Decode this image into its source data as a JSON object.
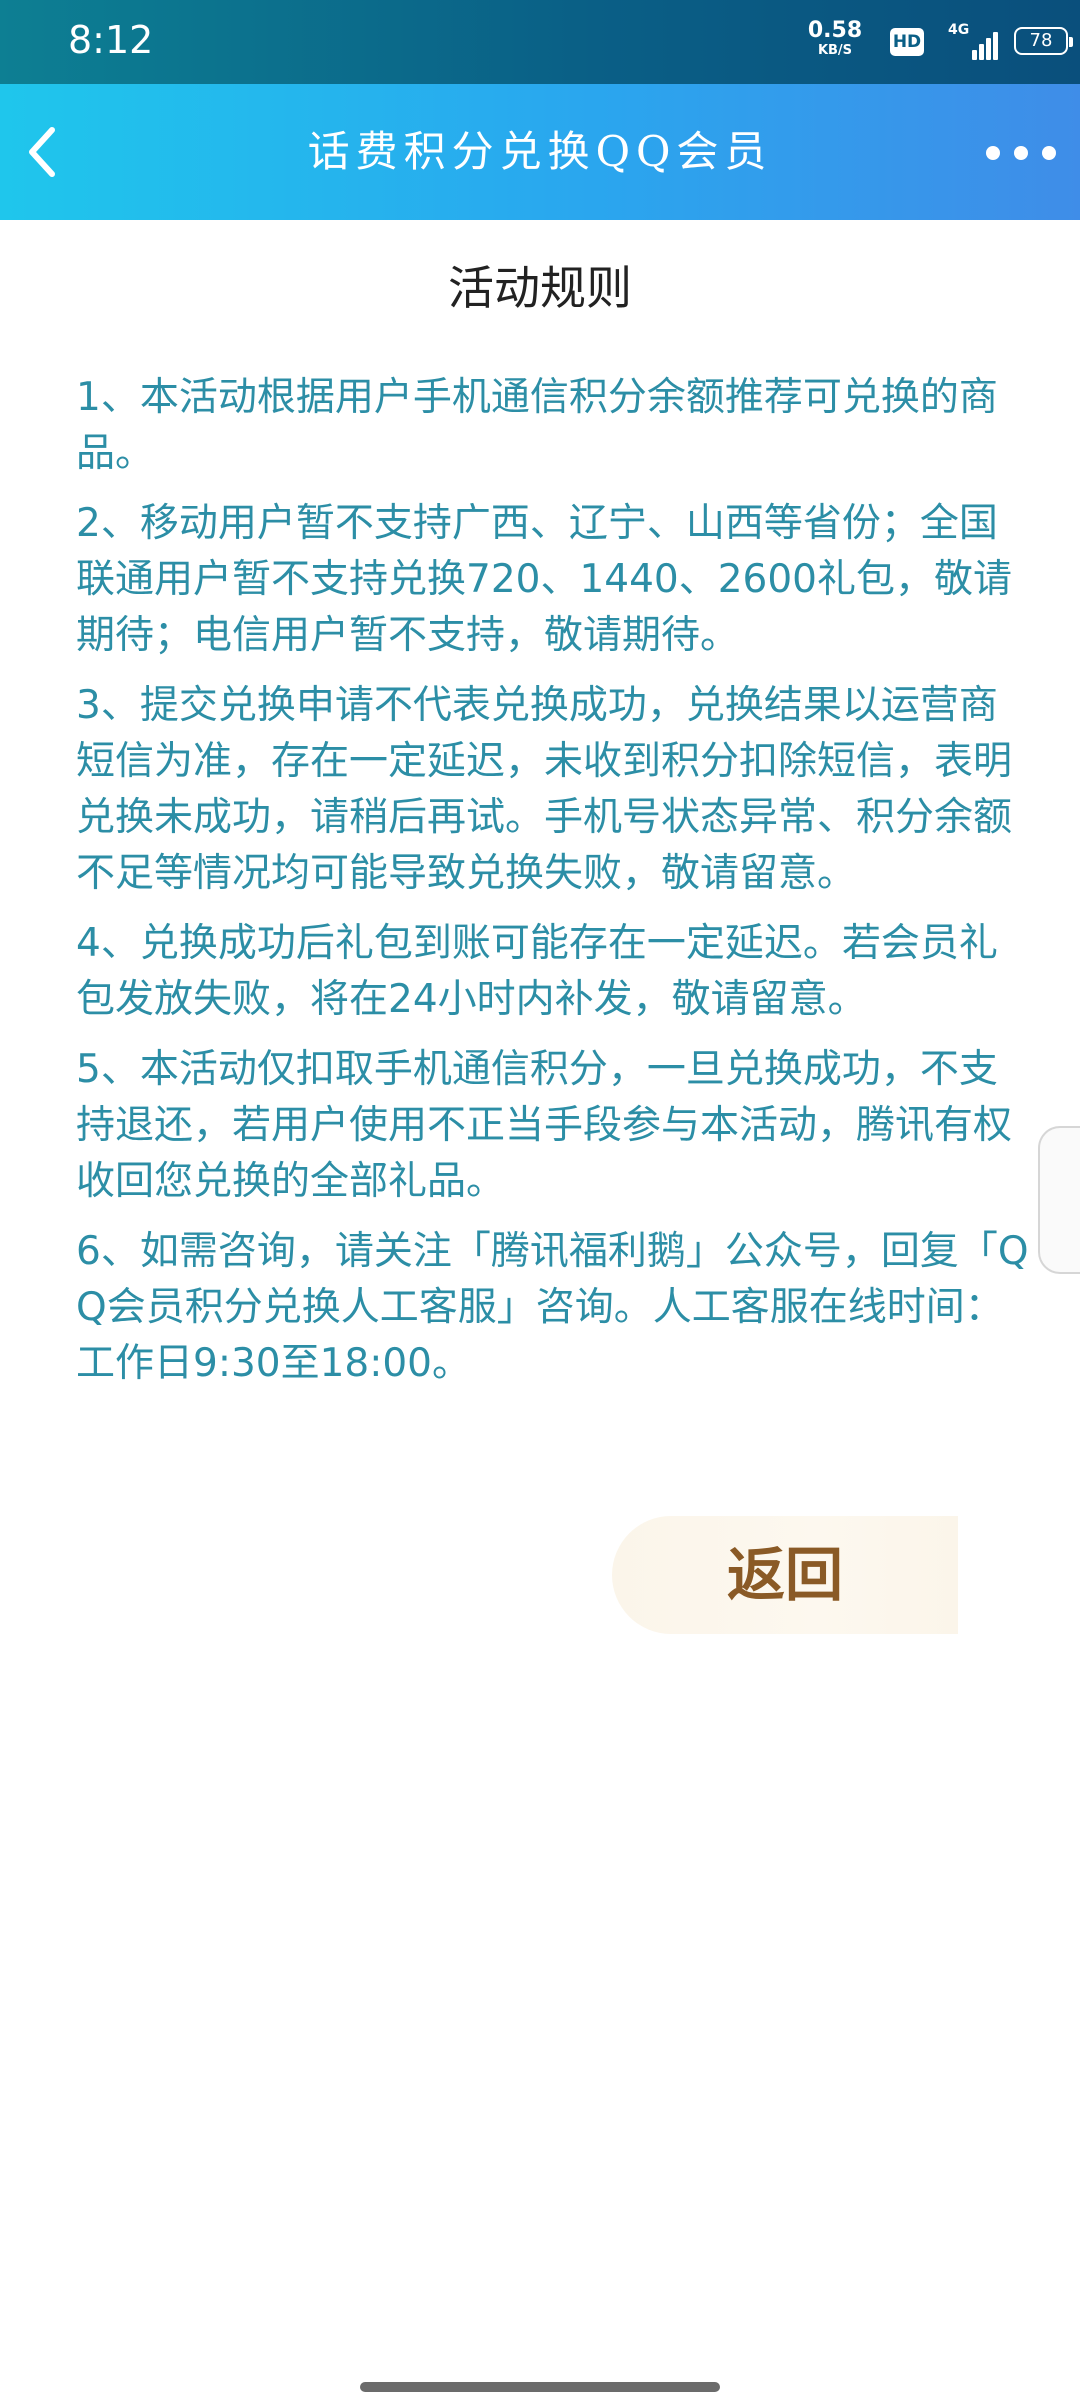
{
  "status_bar": {
    "time": "8:12",
    "net_speed_value": "0.58",
    "net_speed_unit": "KB/S",
    "hd_badge": "HD",
    "network_type": "4G",
    "battery_level": "78"
  },
  "nav_bar": {
    "title": "话费积分兑换QQ会员",
    "back_icon": "chevron-left-icon",
    "more_icon": "more-dots-icon"
  },
  "rules": {
    "title": "活动规则",
    "items": [
      "1、本活动根据用户手机通信积分余额推荐可兑换的商品。",
      "2、移动用户暂不支持广西、辽宁、山西等省份；全国联通用户暂不支持兑换720、1440、2600礼包，敬请期待；电信用户暂不支持，敬请期待。",
      "3、提交兑换申请不代表兑换成功，兑换结果以运营商短信为准，存在一定延迟，未收到积分扣除短信，表明兑换未成功，请稍后再试。手机号状态异常、积分余额不足等情况均可能导致兑换失败，敬请留意。",
      "4、兑换成功后礼包到账可能存在一定延迟。若会员礼包发放失败，将在24小时内补发，敬请留意。",
      "5、本活动仅扣取手机通信积分，一旦兑换成功，不支持退还，若用户使用不正当手段参与本活动，腾讯有权收回您兑换的全部礼品。",
      "6、如需咨询，请关注「腾讯福利鹅」公众号，回复「QQ会员积分兑换人工客服」咨询。人工客服在线时间：工作日9:30至18:00。"
    ]
  },
  "actions": {
    "return_label": "返回"
  },
  "colors": {
    "status_bar_bg": "#0a5f86",
    "nav_gradient_start": "#1fc6ec",
    "nav_gradient_end": "#3f8de8",
    "rule_text": "#2c8ea6",
    "title_text": "#222222",
    "return_text": "#8a5a26",
    "return_bg": "#fbf5ea"
  }
}
